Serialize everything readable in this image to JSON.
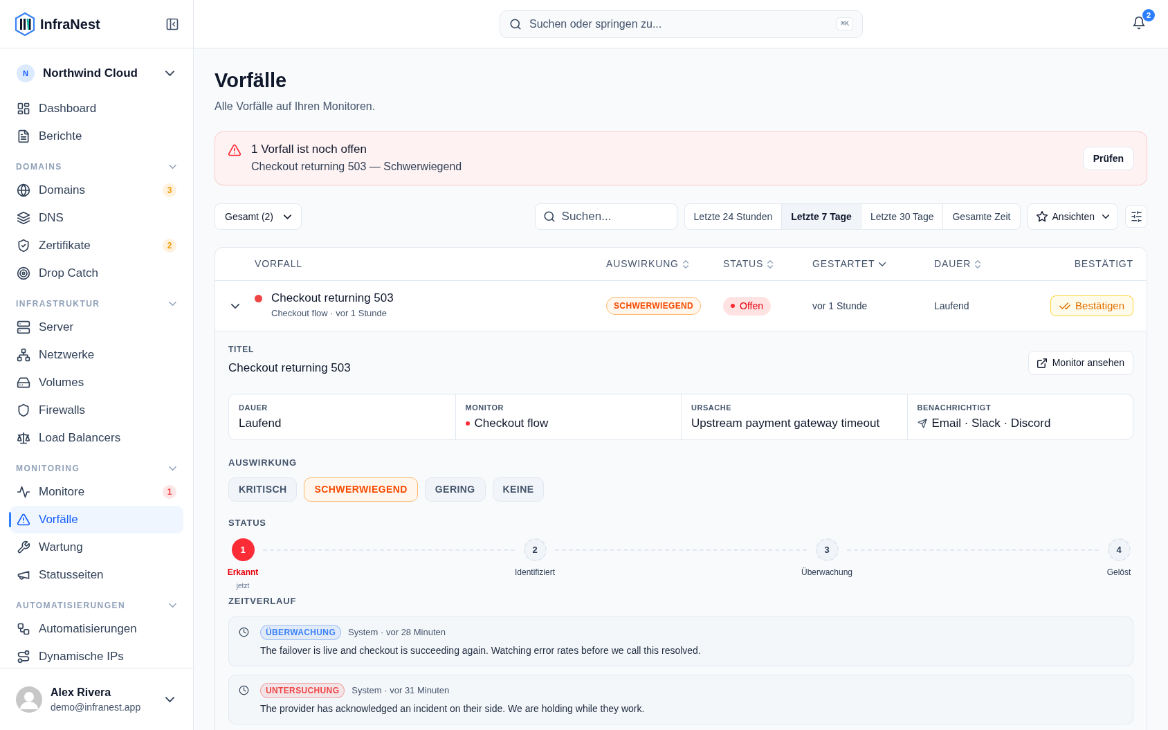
{
  "brand": {
    "name": "InfraNest"
  },
  "workspace": {
    "initial": "N",
    "name": "Northwind Cloud"
  },
  "nav": [
    {
      "items": [
        {
          "label": "Dashboard",
          "selected": false
        },
        {
          "label": "Berichte",
          "selected": false
        }
      ]
    },
    {
      "heading": "DOMAINS",
      "expanded": true,
      "items": [
        {
          "label": "Domains",
          "selected": false,
          "badge": {
            "text": "3",
            "color": "#f59e0b"
          }
        },
        {
          "label": "DNS",
          "selected": false
        },
        {
          "label": "Zertifikate",
          "selected": false,
          "badge": {
            "text": "2",
            "color": "#f59e0b"
          }
        },
        {
          "label": "Drop Catch",
          "selected": false
        }
      ]
    },
    {
      "heading": "INFRASTRUKTUR",
      "expanded": true,
      "items": [
        {
          "label": "Server",
          "selected": false
        },
        {
          "label": "Netzwerke",
          "selected": false
        },
        {
          "label": "Volumes",
          "selected": false
        },
        {
          "label": "Firewalls",
          "selected": false
        },
        {
          "label": "Load Balancers",
          "selected": false
        }
      ]
    },
    {
      "heading": "MONITORING",
      "expanded": true,
      "items": [
        {
          "label": "Monitore",
          "selected": false,
          "badge": {
            "text": "1",
            "color": "#ef4444"
          }
        },
        {
          "label": "Vorfälle",
          "selected": true
        },
        {
          "label": "Wartung",
          "selected": false
        },
        {
          "label": "Statusseiten",
          "selected": false
        }
      ]
    },
    {
      "heading": "AUTOMATISIERUNGEN",
      "expanded": true,
      "items": [
        {
          "label": "Automatisierungen",
          "selected": false
        },
        {
          "label": "Dynamische IPs",
          "selected": false
        }
      ]
    }
  ],
  "user": {
    "name": "Alex Rivera",
    "email": "demo@infranest.app"
  },
  "search": {
    "placeholder": "Suchen oder springen zu...",
    "shortcut": "⌘K"
  },
  "notifications": {
    "count": "2"
  },
  "page": {
    "title": "Vorfälle",
    "subtitle": "Alle Vorfälle auf Ihren Monitoren."
  },
  "alert": {
    "title": "1 Vorfall ist noch offen",
    "text": "Checkout returning 503 — Schwerwiegend",
    "button": "Prüfen"
  },
  "filters": {
    "select": "Gesamt (2)",
    "search_placeholder": "Suchen...",
    "ranges": [
      {
        "label": "Letzte 24 Stunden",
        "selected": false
      },
      {
        "label": "Letzte 7 Tage",
        "selected": true
      },
      {
        "label": "Letzte 30 Tage",
        "selected": false
      },
      {
        "label": "Gesamte Zeit",
        "selected": false
      }
    ],
    "views": "Ansichten"
  },
  "table": {
    "columns": [
      {
        "label": "VORFALL"
      },
      {
        "label": "AUSWIRKUNG",
        "sorted": false
      },
      {
        "label": "STATUS",
        "sorted": false
      },
      {
        "label": "GESTARTET",
        "sorted": true
      },
      {
        "label": "DAUER",
        "sorted": false
      },
      {
        "label": "BESTÄTIGT"
      }
    ],
    "rows": [
      {
        "expanded": true,
        "color": "#ef4444",
        "title": "Checkout returning 503",
        "subtitle": "Checkout flow · vor 1 Stunde",
        "impact": "SCHWERWIEGEND",
        "status": "Offen",
        "started": "vor 1 Stunde",
        "duration": "Laufend",
        "action": "Bestätigen",
        "detail": {
          "title_label": "TITEL",
          "title": "Checkout returning 503",
          "monitor_button": "Monitor ansehen",
          "facts": [
            {
              "kind": "plain",
              "label": "DAUER",
              "value": "Laufend"
            },
            {
              "kind": "dot",
              "label": "MONITOR",
              "value": "Checkout flow"
            },
            {
              "kind": "plain",
              "label": "URSACHE",
              "value": "Upstream payment gateway timeout"
            },
            {
              "kind": "notify",
              "label": "BENACHRICHTIGT",
              "value": "Email · Slack · Discord"
            }
          ],
          "impact_label": "AUSWIRKUNG",
          "impact_options": [
            {
              "label": "KRITISCH",
              "selected": false
            },
            {
              "label": "SCHWERWIEGEND",
              "selected": true
            },
            {
              "label": "GERING",
              "selected": false
            },
            {
              "label": "KEINE",
              "selected": false
            }
          ],
          "status_label": "STATUS",
          "steps": [
            {
              "number": "1",
              "label": "Erkannt",
              "selected": true,
              "time": "jetzt"
            },
            {
              "number": "2",
              "label": "Identifiziert",
              "selected": false
            },
            {
              "number": "3",
              "label": "Überwachung",
              "selected": false
            },
            {
              "number": "4",
              "label": "Gelöst",
              "selected": false
            }
          ],
          "timeline_label": "ZEITVERLAUF",
          "timeline": [
            {
              "tag": "ÜBERWACHUNG",
              "color": "#3b82f6",
              "meta": "System · vor 28 Minuten",
              "text": "The failover is live and checkout is succeeding again. Watching error rates before we call this resolved."
            },
            {
              "tag": "UNTERSUCHUNG",
              "color": "#ef4444",
              "meta": "System · vor 31 Minuten",
              "text": "The provider has acknowledged an incident on their side. We are holding while they work."
            }
          ]
        }
      }
    ]
  }
}
